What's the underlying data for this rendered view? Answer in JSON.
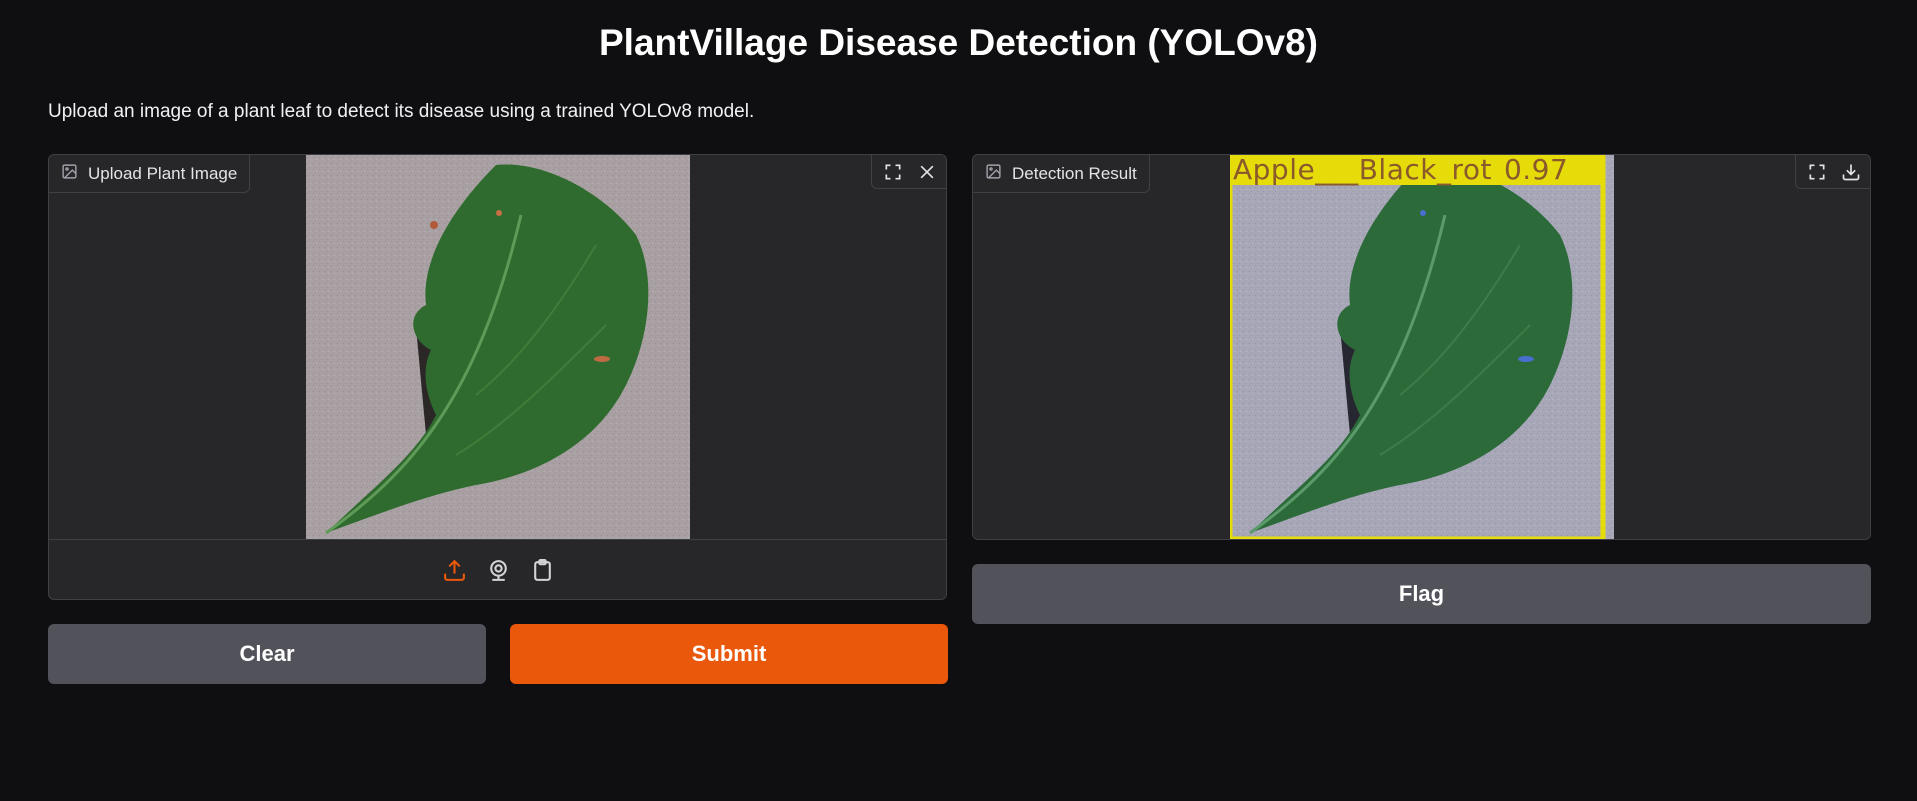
{
  "page": {
    "title": "PlantVillage Disease Detection (YOLOv8)",
    "description": "Upload an image of a plant leaf to detect its disease using a trained YOLOv8 model."
  },
  "input_panel": {
    "label": "Upload Plant Image",
    "label_icon": "image-icon",
    "tools": [
      "fullscreen-icon",
      "close-icon"
    ],
    "sources": [
      "upload-icon",
      "webcam-icon",
      "clipboard-icon"
    ],
    "active_source": "upload-icon"
  },
  "output_panel": {
    "label": "Detection Result",
    "label_icon": "image-icon",
    "tools": [
      "fullscreen-icon",
      "download-icon"
    ],
    "detection": {
      "class_label": "Apple___Black_rot",
      "confidence": "0.97",
      "box_color": "#e6dc0a"
    }
  },
  "buttons": {
    "clear": "Clear",
    "submit": "Submit",
    "flag": "Flag"
  },
  "colors": {
    "background": "#0f0f11",
    "panel": "#27272a",
    "accent": "#ea580c",
    "secondary_button": "#52525b"
  }
}
